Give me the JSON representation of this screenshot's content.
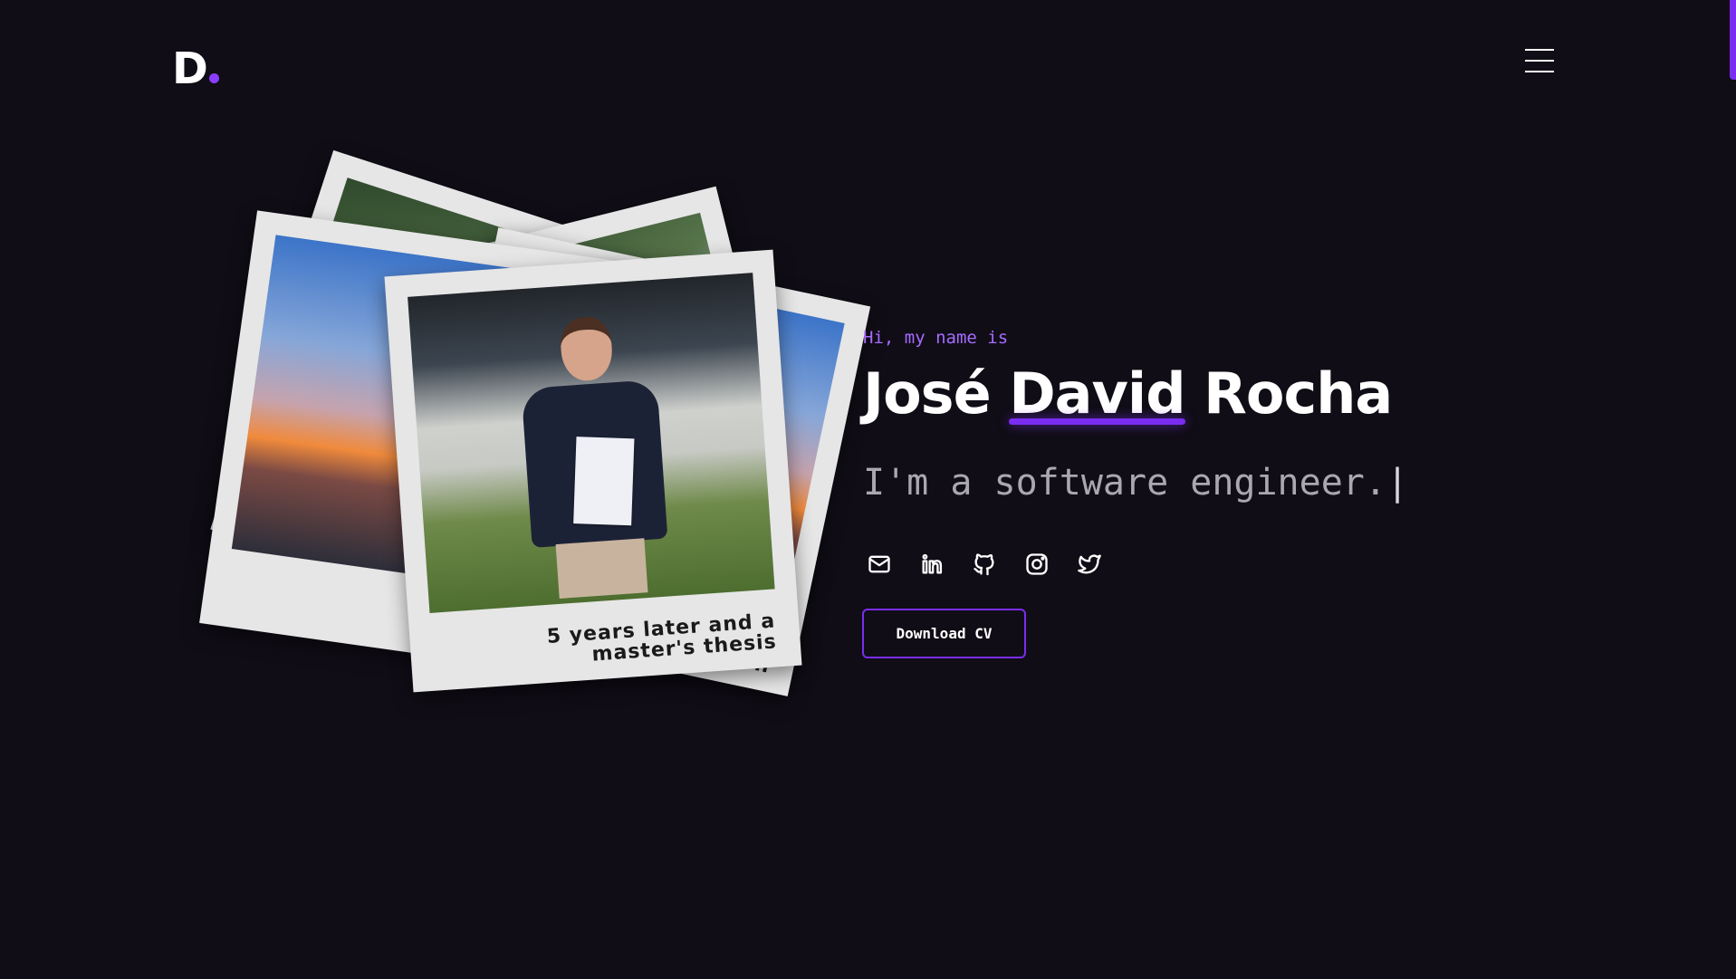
{
  "header": {
    "logo_text": "D",
    "menu_icon": "hamburger-menu-icon"
  },
  "hero": {
    "greeting": "Hi, my name is",
    "name_first": "José",
    "name_highlight": "David",
    "name_last": "Rocha",
    "tagline": "I'm a software engineer.",
    "caret": "|",
    "download_cv_label": "Download CV"
  },
  "polaroids": {
    "front_caption": "5 years later and a master's thesis",
    "peek_caption_fragment": "n"
  },
  "socials": [
    {
      "name": "email",
      "icon": "mail-icon"
    },
    {
      "name": "linkedin",
      "icon": "linkedin-icon"
    },
    {
      "name": "github",
      "icon": "github-icon"
    },
    {
      "name": "instagram",
      "icon": "instagram-icon"
    },
    {
      "name": "twitter",
      "icon": "twitter-icon"
    }
  ],
  "colors": {
    "background": "#100d16",
    "accent": "#7a2df0",
    "greeting": "#a66bff",
    "tagline": "#a9a7b2"
  }
}
